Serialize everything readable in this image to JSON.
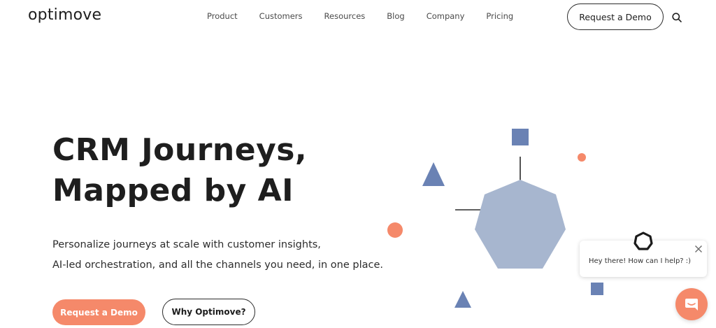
{
  "header": {
    "logo": "optimove",
    "nav": [
      "Product",
      "Customers",
      "Resources",
      "Blog",
      "Company",
      "Pricing"
    ],
    "cta": "Request a Demo"
  },
  "hero": {
    "title_line1": "CRM Journeys,",
    "title_line2": "Mapped by AI",
    "sub_line1": "Personalize journeys at scale with customer insights,",
    "sub_line2": "AI-led orchestration, and all the channels you need, in one place.",
    "primary_cta": "Request a Demo",
    "secondary_cta": "Why Optimove?"
  },
  "chat": {
    "message": "Hey there! How can I help? :)"
  },
  "colors": {
    "accent": "#f5896a",
    "shape_blue": "#6a82b4",
    "shape_light": "#a7b6cf"
  },
  "icons": [
    "search-icon",
    "close-icon",
    "chat-icon",
    "bot-avatar-icon"
  ]
}
